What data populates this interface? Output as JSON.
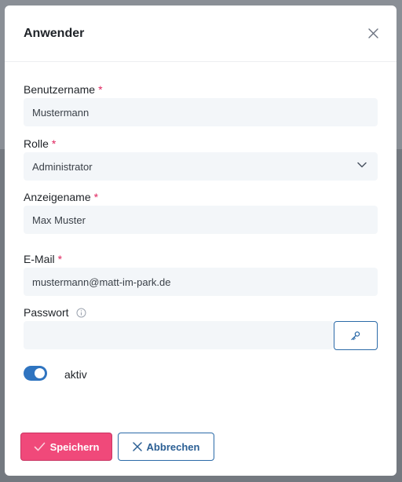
{
  "dialog": {
    "title": "Anwender",
    "close_icon": "close-icon"
  },
  "form": {
    "username": {
      "label": "Benutzername",
      "required_mark": "*",
      "value": "Mustermann"
    },
    "role": {
      "label": "Rolle",
      "required_mark": "*",
      "value": "Administrator",
      "icon": "chevron-down-icon"
    },
    "display_name": {
      "label": "Anzeigename",
      "required_mark": "*",
      "value": "Max Muster"
    },
    "email": {
      "label": "E-Mail",
      "required_mark": "*",
      "value": "mustermann@matt-im-park.de"
    },
    "password": {
      "label": "Passwort",
      "value": "",
      "info_icon": "info-icon",
      "generate_icon": "key-icon"
    },
    "active": {
      "label": "aktiv",
      "checked": true
    }
  },
  "actions": {
    "save_label": "Speichern",
    "cancel_label": "Abbrechen"
  },
  "colors": {
    "accent": "#2f74c0",
    "save": "#f0497a",
    "required": "#e0245e"
  }
}
